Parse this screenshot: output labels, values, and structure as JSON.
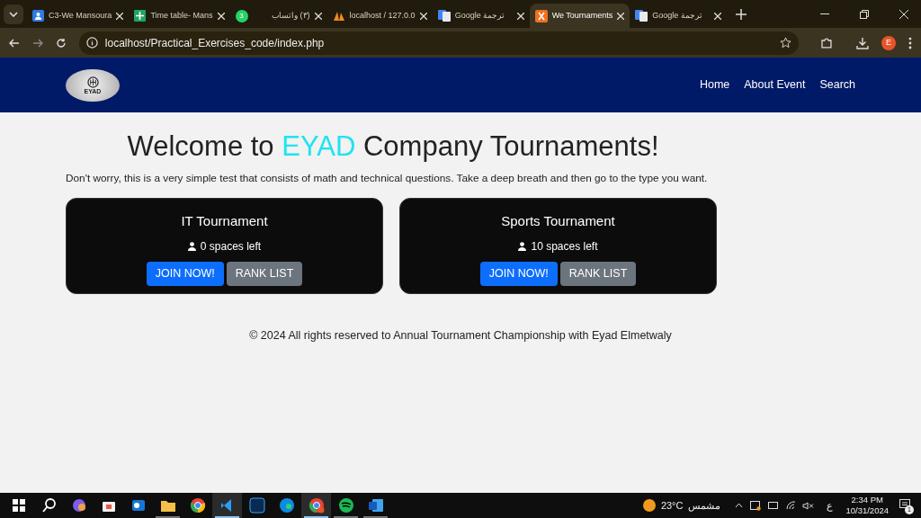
{
  "browser": {
    "tabs": [
      {
        "title": "C3-We Mansoura",
        "selected": false
      },
      {
        "title": "Time table- Mans",
        "selected": false
      },
      {
        "title": "(٣) واتساب",
        "selected": false,
        "badge": "3"
      },
      {
        "title": "localhost / 127.0.0",
        "selected": false
      },
      {
        "title": "Google ترجمة",
        "selected": false
      },
      {
        "title": "We Tournaments",
        "selected": true
      },
      {
        "title": "Google ترجمة",
        "selected": false
      }
    ],
    "address": "localhost/Practical_Exercises_code/index.php",
    "profile": "E"
  },
  "page": {
    "logo_text": "EYAD",
    "nav": [
      {
        "label": "Home"
      },
      {
        "label": "About Event"
      },
      {
        "label": "Search"
      }
    ],
    "heading_before": "Welcome to ",
    "heading_highlight": "EYAD",
    "heading_after": " Company Tournaments!",
    "intro": "Don't worry, this is a very simple test that consists of math and technical questions. Take a deep breath and then go to the type you want.",
    "cards": [
      {
        "title": "IT Tournament",
        "spaces": "0 spaces left",
        "join": "JOIN NOW!",
        "rank": "RANK LIST"
      },
      {
        "title": "Sports Tournament",
        "spaces": "10 spaces left",
        "join": "JOIN NOW!",
        "rank": "RANK LIST"
      }
    ],
    "footer": "© 2024 All rights reserved to Annual Tournament Championship with Eyad Elmetwaly"
  },
  "taskbar": {
    "apps": [
      {
        "open": false,
        "selected": false
      },
      {
        "open": false,
        "selected": false
      },
      {
        "open": false,
        "selected": false
      },
      {
        "open": false,
        "selected": false
      },
      {
        "open": true,
        "selected": false
      },
      {
        "open": false,
        "selected": false
      },
      {
        "open": true,
        "selected": true
      },
      {
        "open": false,
        "selected": false
      },
      {
        "open": false,
        "selected": false
      },
      {
        "open": true,
        "selected": true
      },
      {
        "open": true,
        "selected": false
      },
      {
        "open": true,
        "selected": false
      }
    ],
    "weather_temp": "23°C",
    "weather_text": "مشمس",
    "language": "ع",
    "time": "2:34 PM",
    "date": "10/31/2024",
    "notifications": "1"
  }
}
